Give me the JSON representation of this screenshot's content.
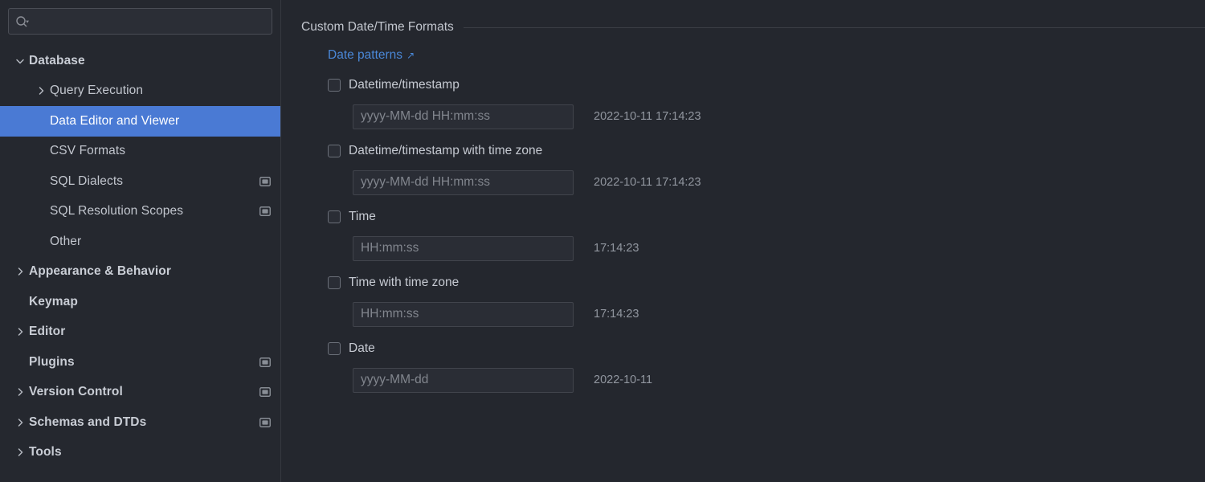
{
  "search": {
    "placeholder": "",
    "value": "",
    "icon": "search-icon"
  },
  "sidebar": {
    "items": [
      {
        "label": "Database",
        "level": 0,
        "chevron": "chevron-down",
        "selected": false,
        "badge": false
      },
      {
        "label": "Query Execution",
        "level": 1,
        "chevron": "chevron-right",
        "selected": false,
        "badge": false
      },
      {
        "label": "Data Editor and Viewer",
        "level": 1,
        "chevron": "none",
        "selected": true,
        "badge": false
      },
      {
        "label": "CSV Formats",
        "level": 1,
        "chevron": "none",
        "selected": false,
        "badge": false
      },
      {
        "label": "SQL Dialects",
        "level": 1,
        "chevron": "none",
        "selected": false,
        "badge": true
      },
      {
        "label": "SQL Resolution Scopes",
        "level": 1,
        "chevron": "none",
        "selected": false,
        "badge": true
      },
      {
        "label": "Other",
        "level": 1,
        "chevron": "none",
        "selected": false,
        "badge": false
      },
      {
        "label": "Appearance & Behavior",
        "level": 0,
        "chevron": "chevron-right",
        "selected": false,
        "badge": false
      },
      {
        "label": "Keymap",
        "level": 0,
        "chevron": "none",
        "selected": false,
        "badge": false
      },
      {
        "label": "Editor",
        "level": 0,
        "chevron": "chevron-right",
        "selected": false,
        "badge": false
      },
      {
        "label": "Plugins",
        "level": 0,
        "chevron": "none",
        "selected": false,
        "badge": true
      },
      {
        "label": "Version Control",
        "level": 0,
        "chevron": "chevron-right",
        "selected": false,
        "badge": true
      },
      {
        "label": "Schemas and DTDs",
        "level": 0,
        "chevron": "chevron-right",
        "selected": false,
        "badge": true
      },
      {
        "label": "Tools",
        "level": 0,
        "chevron": "chevron-right",
        "selected": false,
        "badge": false
      }
    ]
  },
  "main": {
    "section_title": "Custom Date/Time Formats",
    "link": {
      "label": "Date patterns",
      "arrow": "↗"
    },
    "fields": [
      {
        "label": "Datetime/timestamp",
        "checked": false,
        "placeholder": "yyyy-MM-dd HH:mm:ss",
        "value": "",
        "preview": "2022-10-11 17:14:23"
      },
      {
        "label": "Datetime/timestamp with time zone",
        "checked": false,
        "placeholder": "yyyy-MM-dd HH:mm:ss",
        "value": "",
        "preview": "2022-10-11 17:14:23"
      },
      {
        "label": "Time",
        "checked": false,
        "placeholder": "HH:mm:ss",
        "value": "",
        "preview": "17:14:23"
      },
      {
        "label": "Time with time zone",
        "checked": false,
        "placeholder": "HH:mm:ss",
        "value": "",
        "preview": "17:14:23"
      },
      {
        "label": "Date",
        "checked": false,
        "placeholder": "yyyy-MM-dd",
        "value": "",
        "preview": "2022-10-11"
      }
    ]
  },
  "colors": {
    "background": "#24272e",
    "sidebar_background": "#25282f",
    "selection": "#4a7ad4",
    "link": "#4a88d8",
    "text": "#c2c6ce",
    "muted_text": "#9297a0"
  }
}
